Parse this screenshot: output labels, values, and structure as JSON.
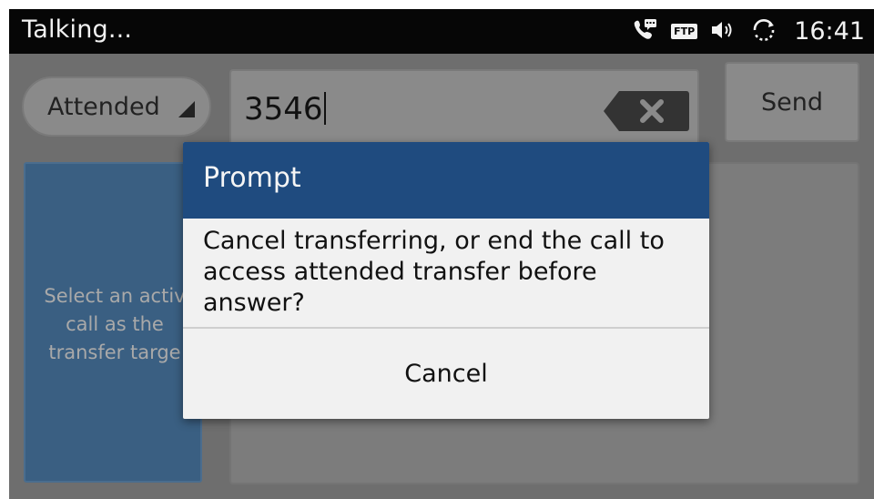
{
  "status_bar": {
    "title": "Talking...",
    "ftp_label": "FTP",
    "time": "16:41",
    "icons": [
      "phone-message-icon",
      "ftp-icon",
      "volume-icon",
      "sync-icon"
    ]
  },
  "transfer": {
    "mode": "Attended",
    "number": "3546",
    "send_label": "Send",
    "target_hint": "Select an activ\ncall as the\ntransfer targe"
  },
  "dialog": {
    "title": "Prompt",
    "message": "Cancel transferring, or end the call to access attended transfer before answer?",
    "cancel_label": "Cancel"
  },
  "colors": {
    "status_bar_bg": "#060606",
    "dialog_header": "#1f4b7f",
    "target_card": "#3a5f82"
  }
}
